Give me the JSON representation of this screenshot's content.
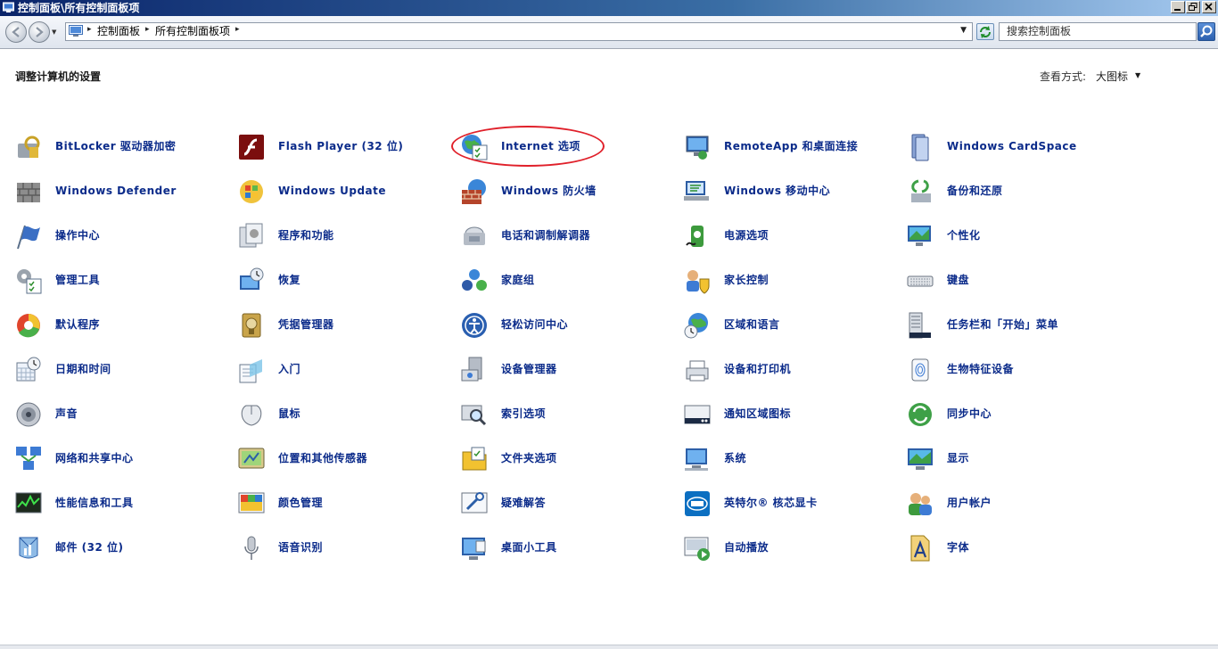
{
  "window": {
    "title": "控制面板\\所有控制面板项"
  },
  "toolbar": {
    "breadcrumbs": [
      "控制面板",
      "所有控制面板项"
    ],
    "search_placeholder": "搜索控制面板"
  },
  "content": {
    "heading": "调整计算机的设置",
    "view_label": "查看方式:",
    "view_value": "大图标"
  },
  "items": [
    {
      "label": "BitLocker 驱动器加密",
      "icon": "bitlocker-icon"
    },
    {
      "label": "Flash Player (32 位)",
      "icon": "flash-player-icon"
    },
    {
      "label": "Internet 选项",
      "icon": "internet-options-icon",
      "highlighted": true
    },
    {
      "label": "RemoteApp 和桌面连接",
      "icon": "remoteapp-icon"
    },
    {
      "label": "Windows CardSpace",
      "icon": "cardspace-icon"
    },
    {
      "label": "Windows Defender",
      "icon": "defender-icon"
    },
    {
      "label": "Windows Update",
      "icon": "windows-update-icon"
    },
    {
      "label": "Windows 防火墙",
      "icon": "firewall-icon"
    },
    {
      "label": "Windows 移动中心",
      "icon": "mobility-center-icon"
    },
    {
      "label": "备份和还原",
      "icon": "backup-restore-icon"
    },
    {
      "label": "操作中心",
      "icon": "action-center-flag-icon"
    },
    {
      "label": "程序和功能",
      "icon": "programs-features-icon"
    },
    {
      "label": "电话和调制解调器",
      "icon": "phone-modem-icon"
    },
    {
      "label": "电源选项",
      "icon": "power-options-icon"
    },
    {
      "label": "个性化",
      "icon": "personalization-icon"
    },
    {
      "label": "管理工具",
      "icon": "admin-tools-icon"
    },
    {
      "label": "恢复",
      "icon": "recovery-icon"
    },
    {
      "label": "家庭组",
      "icon": "homegroup-icon"
    },
    {
      "label": "家长控制",
      "icon": "parental-controls-icon"
    },
    {
      "label": "键盘",
      "icon": "keyboard-icon"
    },
    {
      "label": "默认程序",
      "icon": "default-programs-icon"
    },
    {
      "label": "凭据管理器",
      "icon": "credential-manager-icon"
    },
    {
      "label": "轻松访问中心",
      "icon": "ease-of-access-icon"
    },
    {
      "label": "区域和语言",
      "icon": "region-language-icon"
    },
    {
      "label": "任务栏和「开始」菜单",
      "icon": "taskbar-start-menu-icon"
    },
    {
      "label": "日期和时间",
      "icon": "date-time-icon"
    },
    {
      "label": "入门",
      "icon": "getting-started-icon"
    },
    {
      "label": "设备管理器",
      "icon": "device-manager-icon"
    },
    {
      "label": "设备和打印机",
      "icon": "devices-printers-icon"
    },
    {
      "label": "生物特征设备",
      "icon": "biometric-devices-icon"
    },
    {
      "label": "声音",
      "icon": "sound-icon"
    },
    {
      "label": "鼠标",
      "icon": "mouse-icon"
    },
    {
      "label": "索引选项",
      "icon": "indexing-options-icon"
    },
    {
      "label": "通知区域图标",
      "icon": "notification-area-icon"
    },
    {
      "label": "同步中心",
      "icon": "sync-center-icon"
    },
    {
      "label": "网络和共享中心",
      "icon": "network-sharing-icon"
    },
    {
      "label": "位置和其他传感器",
      "icon": "location-sensors-icon"
    },
    {
      "label": "文件夹选项",
      "icon": "folder-options-icon"
    },
    {
      "label": "系统",
      "icon": "system-icon"
    },
    {
      "label": "显示",
      "icon": "display-icon"
    },
    {
      "label": "性能信息和工具",
      "icon": "performance-icon"
    },
    {
      "label": "颜色管理",
      "icon": "color-management-icon"
    },
    {
      "label": "疑难解答",
      "icon": "troubleshooting-icon"
    },
    {
      "label": "英特尔® 核芯显卡",
      "icon": "intel-graphics-icon"
    },
    {
      "label": "用户帐户",
      "icon": "user-accounts-icon"
    },
    {
      "label": "邮件 (32 位)",
      "icon": "mail-icon"
    },
    {
      "label": "语音识别",
      "icon": "speech-recognition-icon"
    },
    {
      "label": "桌面小工具",
      "icon": "desktop-gadgets-icon"
    },
    {
      "label": "自动播放",
      "icon": "autoplay-icon"
    },
    {
      "label": "字体",
      "icon": "fonts-icon"
    }
  ]
}
